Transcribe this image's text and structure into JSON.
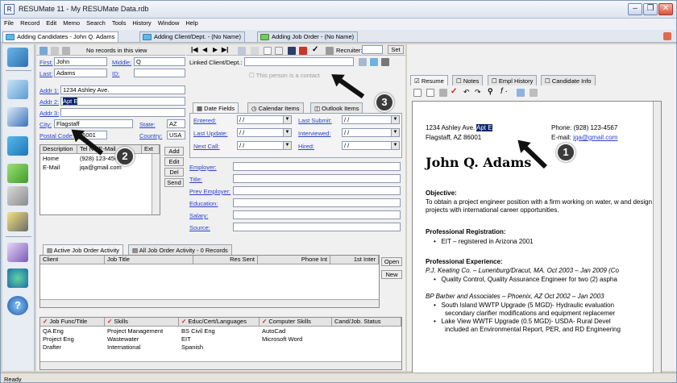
{
  "window": {
    "title": "RESUMate 11 - My RESUMate Data.rdb",
    "app_icon": "R"
  },
  "menu": [
    "File",
    "Record",
    "Edit",
    "Memo",
    "Search",
    "Tools",
    "History",
    "Window",
    "Help"
  ],
  "doc_tabs": [
    {
      "label": "Adding Candidates - John Q. Adams",
      "active": true
    },
    {
      "label": "Adding Client/Dept. - (No Name)",
      "active": false
    },
    {
      "label": "Adding Job Order - (No Name)",
      "active": false
    }
  ],
  "toolbar": {
    "records_text": "No records in this view",
    "recruiter_label": "Recruiter:",
    "set_button": "Set"
  },
  "form": {
    "first_label": "First:",
    "first_value": "John",
    "middle_label": "Middle:",
    "middle_value": "Q",
    "last_label": "Last:",
    "last_value": "Adams",
    "id_label": "ID:",
    "addr1_label": "Addr 1:",
    "addr1_value": "1234 Ashley Ave.",
    "addr2_label": "Addr 2:",
    "addr2_value": "Apt E",
    "addr3_label": "Addr 3:",
    "city_label": "City:",
    "city_value": "Flagstaff",
    "state_label": "State:",
    "state_value": "AZ",
    "postal_label": "Postal Code:",
    "postal_value": "86001",
    "country_label": "Country:",
    "country_value": "USA",
    "linked_label": "Linked Client/Dept.:",
    "contact_checkbox": "This person is a contact"
  },
  "contact_grid": {
    "headers": [
      "Description",
      "Tel No/E-Mail",
      "Ext"
    ],
    "rows": [
      [
        "Home",
        "(928) 123-4567",
        ""
      ],
      [
        "E-Mail",
        "jqa@gmail.com",
        ""
      ]
    ],
    "buttons": [
      "Add",
      "Edit",
      "Del",
      "Send"
    ]
  },
  "date_tabs": [
    "Date Fields",
    "Calendar Items",
    "Outlook Items"
  ],
  "date_fields": [
    {
      "label": "Entered:",
      "value": "/ /"
    },
    {
      "label": "Last Submit:",
      "value": "/ /"
    },
    {
      "label": "Last Update:",
      "value": "/ /"
    },
    {
      "label": "Interviewed:",
      "value": "/ /"
    },
    {
      "label": "Next Call:",
      "value": "/ /"
    },
    {
      "label": "Hired:",
      "value": "/ /"
    }
  ],
  "employment_fields": [
    "Employer:",
    "Title:",
    "Prev Employer:",
    "Education:",
    "Salary:",
    "Source:"
  ],
  "activity": {
    "tabs": [
      "Active Job Order Activity",
      "All Job Order Activity - 0 Records"
    ],
    "headers": [
      "Client",
      "Job Title",
      "Res Sent",
      "Phone Int",
      "1st Inter"
    ],
    "buttons": [
      "Open",
      "New"
    ]
  },
  "skills": {
    "headers": [
      "Job Func/Title",
      "Skills",
      "Educ/Cert/Languages",
      "Computer Skills",
      "Cand/Job. Status"
    ],
    "rows": [
      [
        "QA Eng",
        "Project Management",
        "BS Civil Eng",
        "AutoCad",
        ""
      ],
      [
        "Project Eng",
        "Wastewater",
        "EIT",
        "Microsoft Word",
        ""
      ],
      [
        "Drafter",
        "International",
        "Spanish",
        "",
        ""
      ]
    ]
  },
  "right_tabs": [
    "Resume",
    "Notes",
    "Empl History",
    "Candidate Info"
  ],
  "resume": {
    "address1": "1234 Ashley Ave. ",
    "address1_sel": "Apt E",
    "address2": "Flagstaff, AZ 86001",
    "phone": "Phone: (928) 123-4567",
    "email_label": "E-mail: ",
    "email": "jqa@gmail.com",
    "name": "John Q. Adams",
    "objective_head": "Objective:",
    "objective_text": "To obtain a project engineer position with a firm working on water, w and design projects with international career opportunities.",
    "reg_head": "Professional Registration:",
    "reg_item": "EIT – registered in Arizona 2001",
    "exp_head": "Professional Experience:",
    "exp1": "P.J. Keating Co. – Lunenburg/Dracut, MA.  Oct 2003 – Jan 2009 (Co",
    "exp1_item": "Quality Control, Quality Assurance Engineer for two (2) aspha",
    "exp2": "BP Barber and Associates – Phoenix, AZ   Oct 2002 – Jan 2003",
    "exp2_item1": "South Island WWTP Upgrade (5 MGD)- Hydraulic evaluation",
    "exp2_item1b": "secondary clarifier modifications and equipment replacemer",
    "exp2_item2": "Lake View WWTF Upgrade (0.5 MGD)- USDA- Rural Devel",
    "exp2_item2b": "included an Environmental Report, PER, and RD Engineering"
  },
  "callouts": [
    "1",
    "2",
    "3"
  ],
  "status": "Ready"
}
